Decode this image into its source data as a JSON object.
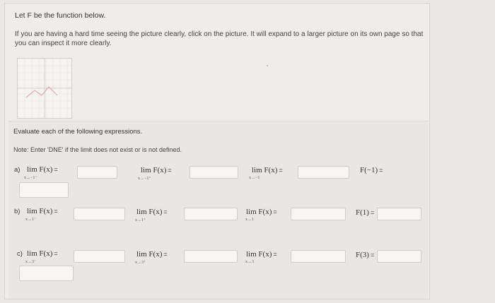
{
  "intro": "Let F be the function below.",
  "hint": "If you are having a hard time seeing the picture clearly, click on the picture. It will expand to a larger picture on its own page so that you can inspect it more clearly.",
  "evaluate": "Evaluate each of the following expressions.",
  "note": "Note: Enter 'DNE' if the limit does not exist or is not defined.",
  "parts": [
    {
      "label": "a)",
      "items": [
        {
          "lim": "lim",
          "fx": "F(x)",
          "eq": "=",
          "sub": "x→−1⁻",
          "value": ""
        },
        {
          "lim": "lim",
          "fx": "F(x)",
          "eq": "=",
          "sub": "x→−1⁺",
          "value": ""
        },
        {
          "lim": "lim",
          "fx": "F(x)",
          "eq": "=",
          "sub": "x→−1",
          "value": ""
        },
        {
          "lim": "",
          "fx": "F(−1)",
          "eq": "=",
          "sub": "",
          "value": ""
        }
      ]
    },
    {
      "label": "b)",
      "items": [
        {
          "lim": "lim",
          "fx": "F(x)",
          "eq": "=",
          "sub": "x→1⁻",
          "value": ""
        },
        {
          "lim": "lim",
          "fx": "F(x)",
          "eq": "=",
          "sub": "x→1⁺",
          "value": ""
        },
        {
          "lim": "lim",
          "fx": "F(x)",
          "eq": "=",
          "sub": "x→1",
          "value": ""
        },
        {
          "lim": "",
          "fx": "F(1)",
          "eq": "=",
          "sub": "",
          "value": ""
        }
      ]
    },
    {
      "label": "c)",
      "items": [
        {
          "lim": "lim",
          "fx": "F(x)",
          "eq": "=",
          "sub": "x→3⁻",
          "value": ""
        },
        {
          "lim": "lim",
          "fx": "F(x)",
          "eq": "=",
          "sub": "x→3⁺",
          "value": ""
        },
        {
          "lim": "lim",
          "fx": "F(x)",
          "eq": "=",
          "sub": "x→3",
          "value": ""
        },
        {
          "lim": "",
          "fx": "F(3)",
          "eq": "=",
          "sub": "",
          "value": ""
        }
      ]
    }
  ]
}
